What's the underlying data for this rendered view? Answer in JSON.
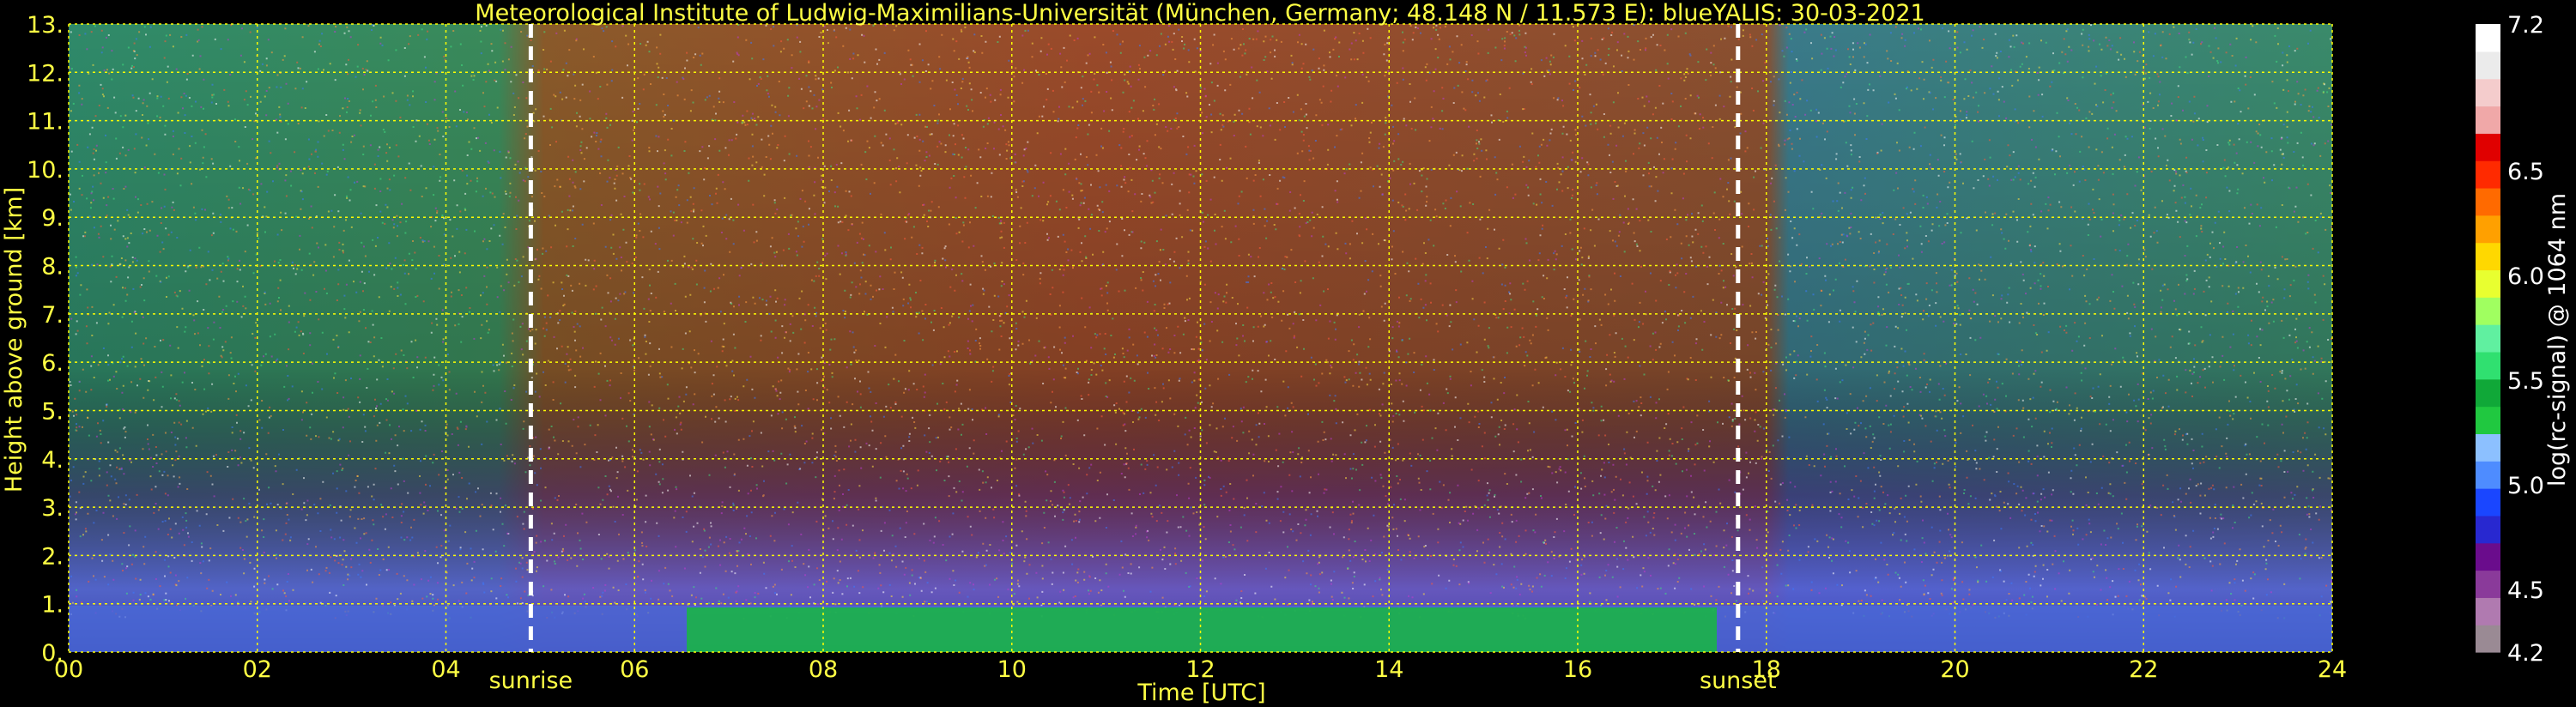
{
  "chart_data": {
    "type": "heatmap",
    "title": "Meteorological Institute of Ludwig-Maximilians-Universität (München, Germany; 48.148 N / 11.573 E):     blueYALIS: 30-03-2021",
    "xlabel": "Time [UTC]",
    "ylabel": "Height above ground [km]",
    "xlim": [
      0,
      24
    ],
    "ylim": [
      0,
      13
    ],
    "x_ticks": [
      "00",
      "02",
      "04",
      "06",
      "08",
      "10",
      "12",
      "14",
      "16",
      "18",
      "20",
      "22",
      "24"
    ],
    "x_tick_values": [
      0,
      2,
      4,
      6,
      8,
      10,
      12,
      14,
      16,
      18,
      20,
      22,
      24
    ],
    "y_ticks": [
      "0.",
      "1.",
      "2.",
      "3.",
      "4.",
      "5.",
      "6.",
      "7.",
      "8.",
      "9.",
      "10.",
      "11.",
      "12.",
      "13."
    ],
    "y_tick_values": [
      0,
      1,
      2,
      3,
      4,
      5,
      6,
      7,
      8,
      9,
      10,
      11,
      12,
      13
    ],
    "grid": true,
    "markers": [
      {
        "label": "sunrise",
        "time": 4.9
      },
      {
        "label": "sunset",
        "time": 17.7
      }
    ],
    "colorbar": {
      "label": "log(rc-signal) @ 1064 nm",
      "range": [
        4.2,
        7.2
      ],
      "ticks": [
        "4.2",
        "4.5",
        "5.0",
        "5.5",
        "6.0",
        "6.5",
        "7.2"
      ],
      "tick_values": [
        4.2,
        4.5,
        5.0,
        5.5,
        6.0,
        6.5,
        7.2
      ],
      "colors": [
        "#9a8a94",
        "#b07ab0",
        "#8a3a9a",
        "#6a0c8c",
        "#2828d0",
        "#1a46ff",
        "#4e8cff",
        "#8cc0ff",
        "#20c840",
        "#10a838",
        "#30e070",
        "#60f0a0",
        "#a0ff60",
        "#e8ff30",
        "#ffd800",
        "#ffa000",
        "#ff6a00",
        "#ff2a00",
        "#e00000",
        "#f0a8a8",
        "#f4cccc",
        "#ebebeb",
        "#ffffff"
      ]
    }
  }
}
